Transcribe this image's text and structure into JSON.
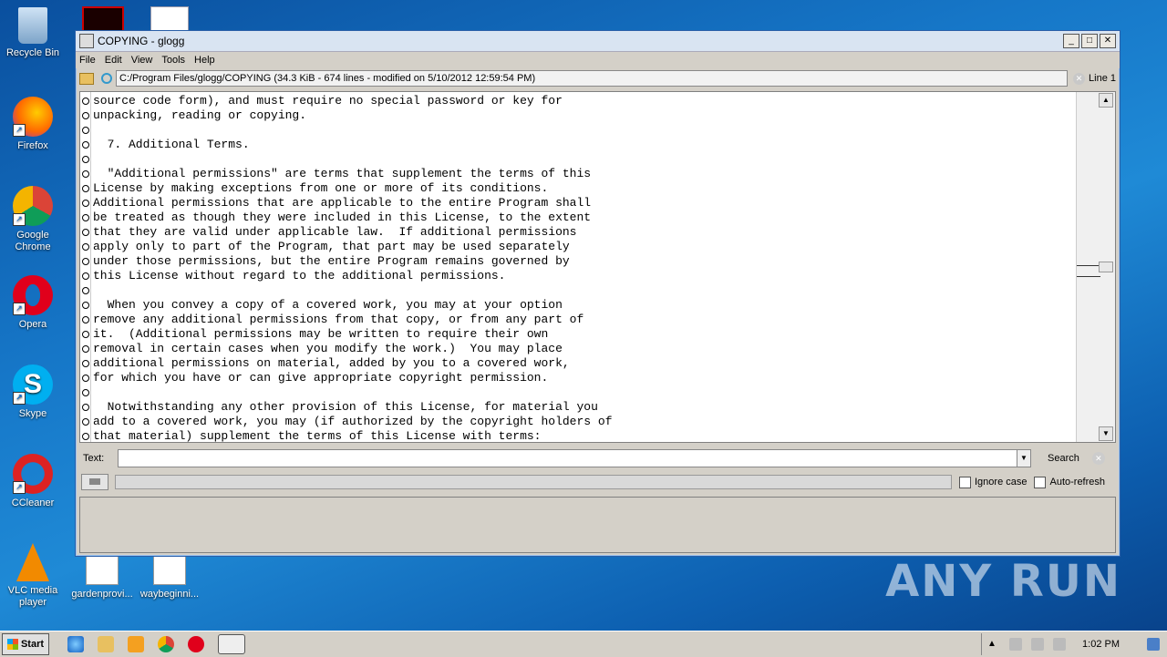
{
  "desktop": {
    "icons": [
      {
        "label": "Recycle Bin"
      },
      {
        "label": "Firefox"
      },
      {
        "label": "Google Chrome"
      },
      {
        "label": "Opera"
      },
      {
        "label": "Skype"
      },
      {
        "label": "CCleaner"
      },
      {
        "label": "VLC media player"
      },
      {
        "label": "gardenprovi..."
      },
      {
        "label": "waybeginni..."
      }
    ],
    "watermark": "ANY RUN"
  },
  "window": {
    "title": "COPYING - glogg",
    "controls": {
      "minimize": "_",
      "maximize": "□",
      "close": "✕"
    },
    "menu": [
      "File",
      "Edit",
      "View",
      "Tools",
      "Help"
    ],
    "path": "C:/Program Files/glogg/COPYING (34.3 KiB - 674 lines - modified on 5/10/2012 12:59:54 PM)",
    "line_info": "Line 1",
    "lines": [
      "source code form), and must require no special password or key for",
      "unpacking, reading or copying.",
      "",
      "  7. Additional Terms.",
      "",
      "  \"Additional permissions\" are terms that supplement the terms of this",
      "License by making exceptions from one or more of its conditions.",
      "Additional permissions that are applicable to the entire Program shall",
      "be treated as though they were included in this License, to the extent",
      "that they are valid under applicable law.  If additional permissions",
      "apply only to part of the Program, that part may be used separately",
      "under those permissions, but the entire Program remains governed by",
      "this License without regard to the additional permissions.",
      "",
      "  When you convey a copy of a covered work, you may at your option",
      "remove any additional permissions from that copy, or from any part of",
      "it.  (Additional permissions may be written to require their own",
      "removal in certain cases when you modify the work.)  You may place",
      "additional permissions on material, added by you to a covered work,",
      "for which you have or can give appropriate copyright permission.",
      "",
      "  Notwithstanding any other provision of this License, for material you",
      "add to a covered work, you may (if authorized by the copyright holders of",
      "that material) supplement the terms of this License with terms:"
    ],
    "search": {
      "label": "Text:",
      "value": "",
      "button": "Search",
      "ignore_case": "Ignore case",
      "auto_refresh": "Auto-refresh"
    }
  },
  "taskbar": {
    "start": "Start",
    "clock": "1:02 PM"
  },
  "colors": {
    "desktop_bg": "#1677c8",
    "window_bg": "#d4d0c8"
  }
}
